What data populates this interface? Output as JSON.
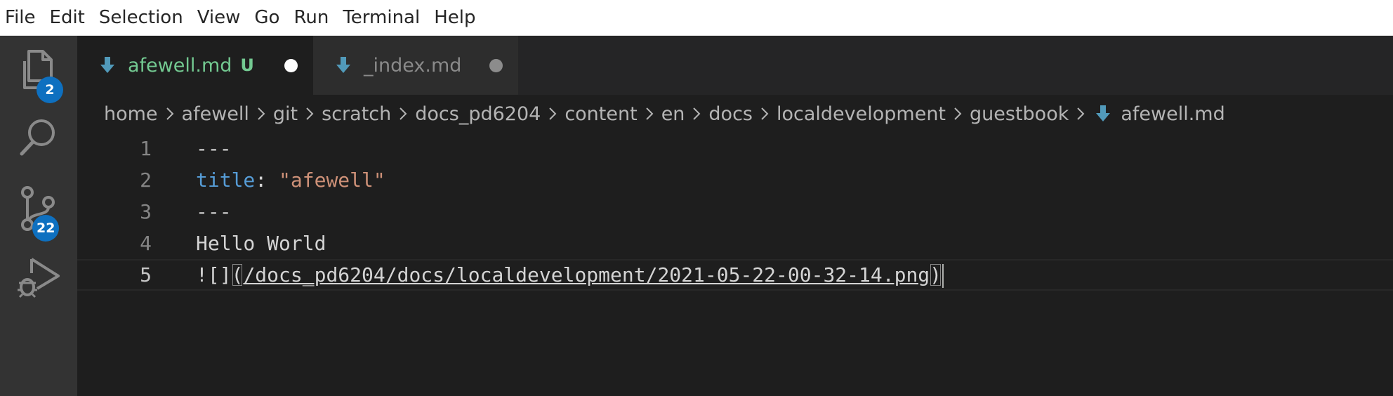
{
  "menu": [
    "File",
    "Edit",
    "Selection",
    "View",
    "Go",
    "Run",
    "Terminal",
    "Help"
  ],
  "activity_bar": {
    "items": [
      {
        "name": "explorer",
        "icon": "files-icon",
        "badge": "2"
      },
      {
        "name": "search",
        "icon": "search-icon",
        "badge": ""
      },
      {
        "name": "source-control",
        "icon": "source-control-icon",
        "badge": "22"
      },
      {
        "name": "run-and-debug",
        "icon": "run-debug-icon",
        "badge": ""
      }
    ]
  },
  "tabs": [
    {
      "label": "afewell.md",
      "flag": "U",
      "active": true,
      "icon": "markdown-icon",
      "dirty": true
    },
    {
      "label": "_index.md",
      "flag": "",
      "active": false,
      "icon": "markdown-icon",
      "dirty": true
    }
  ],
  "breadcrumb": {
    "segments": [
      "home",
      "afewell",
      "git",
      "scratch",
      "docs_pd6204",
      "content",
      "en",
      "docs",
      "localdevelopment",
      "guestbook"
    ],
    "file": "afewell.md"
  },
  "editor": {
    "lines": [
      {
        "number": "1",
        "text": "---"
      },
      {
        "number": "2",
        "key": "title",
        "sep": ": ",
        "value": "\"afewell\""
      },
      {
        "number": "3",
        "text": "---"
      },
      {
        "number": "4",
        "text": "Hello World"
      },
      {
        "number": "5",
        "prefix": "![]",
        "open": "(",
        "url": "/docs_pd6204/docs/localdevelopment/2021-05-22-00-32-14.png",
        "close": ")"
      }
    ],
    "current_line": 5
  },
  "colors": {
    "accent_badge": "#0e70c0",
    "untracked_green": "#73c991",
    "yaml_key": "#569cd6",
    "string": "#ce9178",
    "markdown_icon": "#519aba"
  }
}
